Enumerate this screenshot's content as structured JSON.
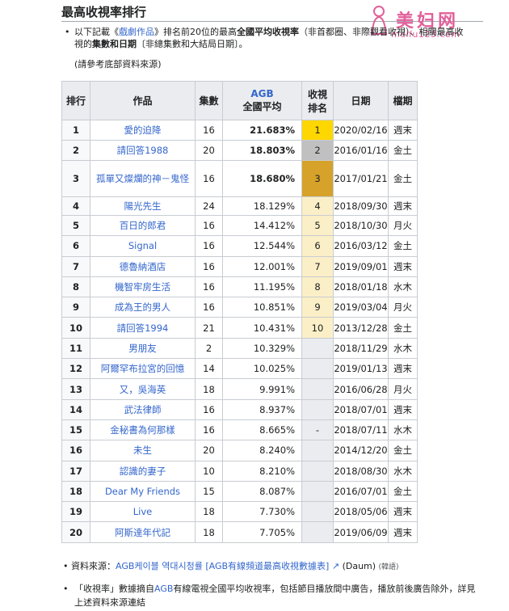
{
  "page": {
    "heading": "最高收視率排行",
    "watermark_text": "美妇网",
    "watermark_url": "meifu123.com",
    "intro_pre": "以下記載《",
    "intro_link": "戲劇作品",
    "intro_mid": "》排名前20位的最高",
    "intro_bold1": "全國平均收視率",
    "intro_mid2": "（非首都圈、非際觀看收視）、相關最高收視的",
    "intro_bold2": "集數和日期",
    "intro_post": "〔非總集數和大結局日期〕。",
    "note": "(請參考底部資料來源)",
    "source_label": "資料來源：",
    "source_link": "AGB케이블 역대시청률 [AGB有線頻道最高收視數據表]",
    "source_post": "(Daum)",
    "source_lang": "(韓語)",
    "def_pre": "「收視率」數據摘自",
    "def_link": "AGB",
    "def_post": "有線電視全國平均收視率，包括節目播放間中廣告，播放前後廣告除外，詳見上述資料來源連結"
  },
  "table": {
    "headers": {
      "rank": "排行",
      "title": "作品",
      "episode": "集數",
      "agb": "AGB",
      "avg": "全國平均",
      "pos_line1": "收視",
      "pos_line2": "排名",
      "date": "日期",
      "slot": "檔期"
    },
    "rows": [
      {
        "rank": "1",
        "title": "愛的迫降",
        "episode": "16",
        "rating": "21.683%",
        "pos": "1",
        "date": "2020/02/16",
        "slot": "週末",
        "pos_color": "#ffd700",
        "bold": true
      },
      {
        "rank": "2",
        "title": "請回答1988",
        "episode": "20",
        "rating": "18.803%",
        "pos": "2",
        "date": "2016/01/16",
        "slot": "金土",
        "pos_color": "#c0c0c0",
        "bold": true
      },
      {
        "rank": "3",
        "title": "孤單又燦爛的神－鬼怪",
        "episode": "16",
        "rating": "18.680%",
        "pos": "3",
        "date": "2017/01/21",
        "slot": "金土",
        "pos_color": "#d6a22a",
        "bold": true
      },
      {
        "rank": "4",
        "title": "陽光先生",
        "episode": "24",
        "rating": "18.129%",
        "pos": "4",
        "date": "2018/09/30",
        "slot": "週末",
        "pos_color": "#fbefc7",
        "bold": false
      },
      {
        "rank": "5",
        "title": "百日的郎君",
        "episode": "16",
        "rating": "14.412%",
        "pos": "5",
        "date": "2018/10/30",
        "slot": "月火",
        "pos_color": "#fbefc7",
        "bold": false
      },
      {
        "rank": "6",
        "title": "Signal",
        "episode": "16",
        "rating": "12.544%",
        "pos": "6",
        "date": "2016/03/12",
        "slot": "金土",
        "pos_color": "#fbefc7",
        "bold": false
      },
      {
        "rank": "7",
        "title": "德魯納酒店",
        "episode": "16",
        "rating": "12.001%",
        "pos": "7",
        "date": "2019/09/01",
        "slot": "週末",
        "pos_color": "#fbefc7",
        "bold": false
      },
      {
        "rank": "8",
        "title": "機智牢房生活",
        "episode": "16",
        "rating": "11.195%",
        "pos": "8",
        "date": "2018/01/18",
        "slot": "水木",
        "pos_color": "#fbefc7",
        "bold": false
      },
      {
        "rank": "9",
        "title": "成為王的男人",
        "episode": "16",
        "rating": "10.851%",
        "pos": "9",
        "date": "2019/03/04",
        "slot": "月火",
        "pos_color": "#fbefc7",
        "bold": false
      },
      {
        "rank": "10",
        "title": "請回答1994",
        "episode": "21",
        "rating": "10.431%",
        "pos": "10",
        "date": "2013/12/28",
        "slot": "金土",
        "pos_color": "#fbefc7",
        "bold": false
      },
      {
        "rank": "11",
        "title": "男朋友",
        "episode": "2",
        "rating": "10.329%",
        "pos": "",
        "date": "2018/11/29",
        "slot": "水木",
        "pos_color": "#eaecf0",
        "bold": false
      },
      {
        "rank": "12",
        "title": "阿爾罕布拉宮的回憶",
        "episode": "14",
        "rating": "10.025%",
        "pos": "",
        "date": "2019/01/13",
        "slot": "週末",
        "pos_color": "#eaecf0",
        "bold": false
      },
      {
        "rank": "13",
        "title": "又，吳海英",
        "episode": "18",
        "rating": "9.991%",
        "pos": "",
        "date": "2016/06/28",
        "slot": "月火",
        "pos_color": "#eaecf0",
        "bold": false
      },
      {
        "rank": "14",
        "title": "武法律師",
        "episode": "16",
        "rating": "8.937%",
        "pos": "",
        "date": "2018/07/01",
        "slot": "週末",
        "pos_color": "#eaecf0",
        "bold": false
      },
      {
        "rank": "15",
        "title": "金秘書為何那樣",
        "episode": "16",
        "rating": "8.665%",
        "pos": "-",
        "date": "2018/07/11",
        "slot": "水木",
        "pos_color": "#eaecf0",
        "bold": false
      },
      {
        "rank": "16",
        "title": "未生",
        "episode": "20",
        "rating": "8.240%",
        "pos": "",
        "date": "2014/12/20",
        "slot": "金土",
        "pos_color": "#eaecf0",
        "bold": false
      },
      {
        "rank": "17",
        "title": "認識的妻子",
        "episode": "10",
        "rating": "8.210%",
        "pos": "",
        "date": "2018/08/30",
        "slot": "水木",
        "pos_color": "#eaecf0",
        "bold": false
      },
      {
        "rank": "18",
        "title": "Dear My Friends",
        "episode": "15",
        "rating": "8.087%",
        "pos": "",
        "date": "2016/07/01",
        "slot": "金土",
        "pos_color": "#eaecf0",
        "bold": false
      },
      {
        "rank": "19",
        "title": "Live",
        "episode": "18",
        "rating": "7.730%",
        "pos": "",
        "date": "2018/05/06",
        "slot": "週末",
        "pos_color": "#eaecf0",
        "bold": false
      },
      {
        "rank": "20",
        "title": "阿斯達年代記",
        "episode": "18",
        "rating": "7.705%",
        "pos": "",
        "date": "2019/06/09",
        "slot": "週末",
        "pos_color": "#eaecf0",
        "bold": false
      }
    ]
  }
}
